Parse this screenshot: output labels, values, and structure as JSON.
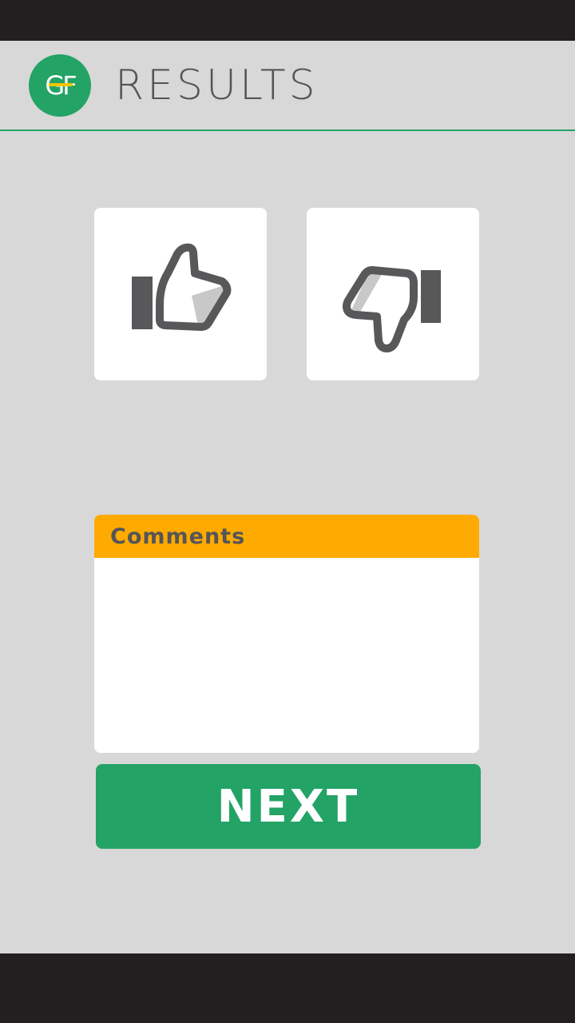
{
  "header": {
    "logo_text": "GF",
    "title": "RESULTS"
  },
  "vote": {
    "thumbs_up_icon": "thumbs-up-icon",
    "thumbs_down_icon": "thumbs-down-icon"
  },
  "comments": {
    "label": "Comments",
    "value": "",
    "placeholder": ""
  },
  "actions": {
    "next_label": "NEXT"
  },
  "colors": {
    "brand_green": "#23a365",
    "accent_orange": "#ffaa00",
    "background": "#d8d8d8",
    "icon_gray": "#58585a",
    "system_bar": "#231f20"
  }
}
